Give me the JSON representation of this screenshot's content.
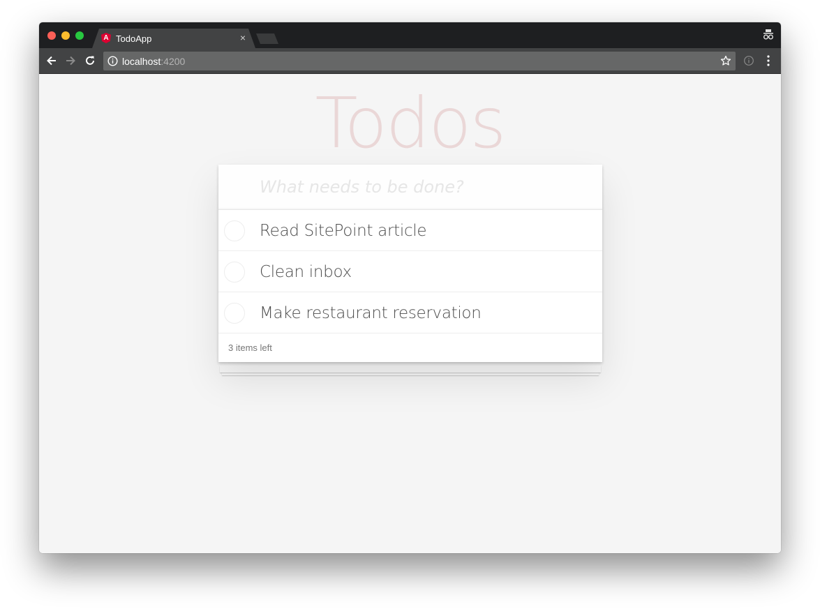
{
  "browser": {
    "tab_title": "TodoApp",
    "tab_close": "×",
    "url_host": "localhost",
    "url_port": ":4200",
    "favicon_letter": "A"
  },
  "app": {
    "title": "Todos",
    "new_todo_placeholder": "What needs to be done?",
    "todos": [
      {
        "title": "Read SitePoint article",
        "complete": false
      },
      {
        "title": "Clean inbox",
        "complete": false
      },
      {
        "title": "Make restaurant reservation",
        "complete": false
      }
    ],
    "items_left": "3 items left"
  },
  "colors": {
    "title": "rgba(175,47,47,0.15)",
    "chrome_dark": "#1e1f21",
    "toolbar": "#424344",
    "page_bg": "#f5f5f5"
  }
}
